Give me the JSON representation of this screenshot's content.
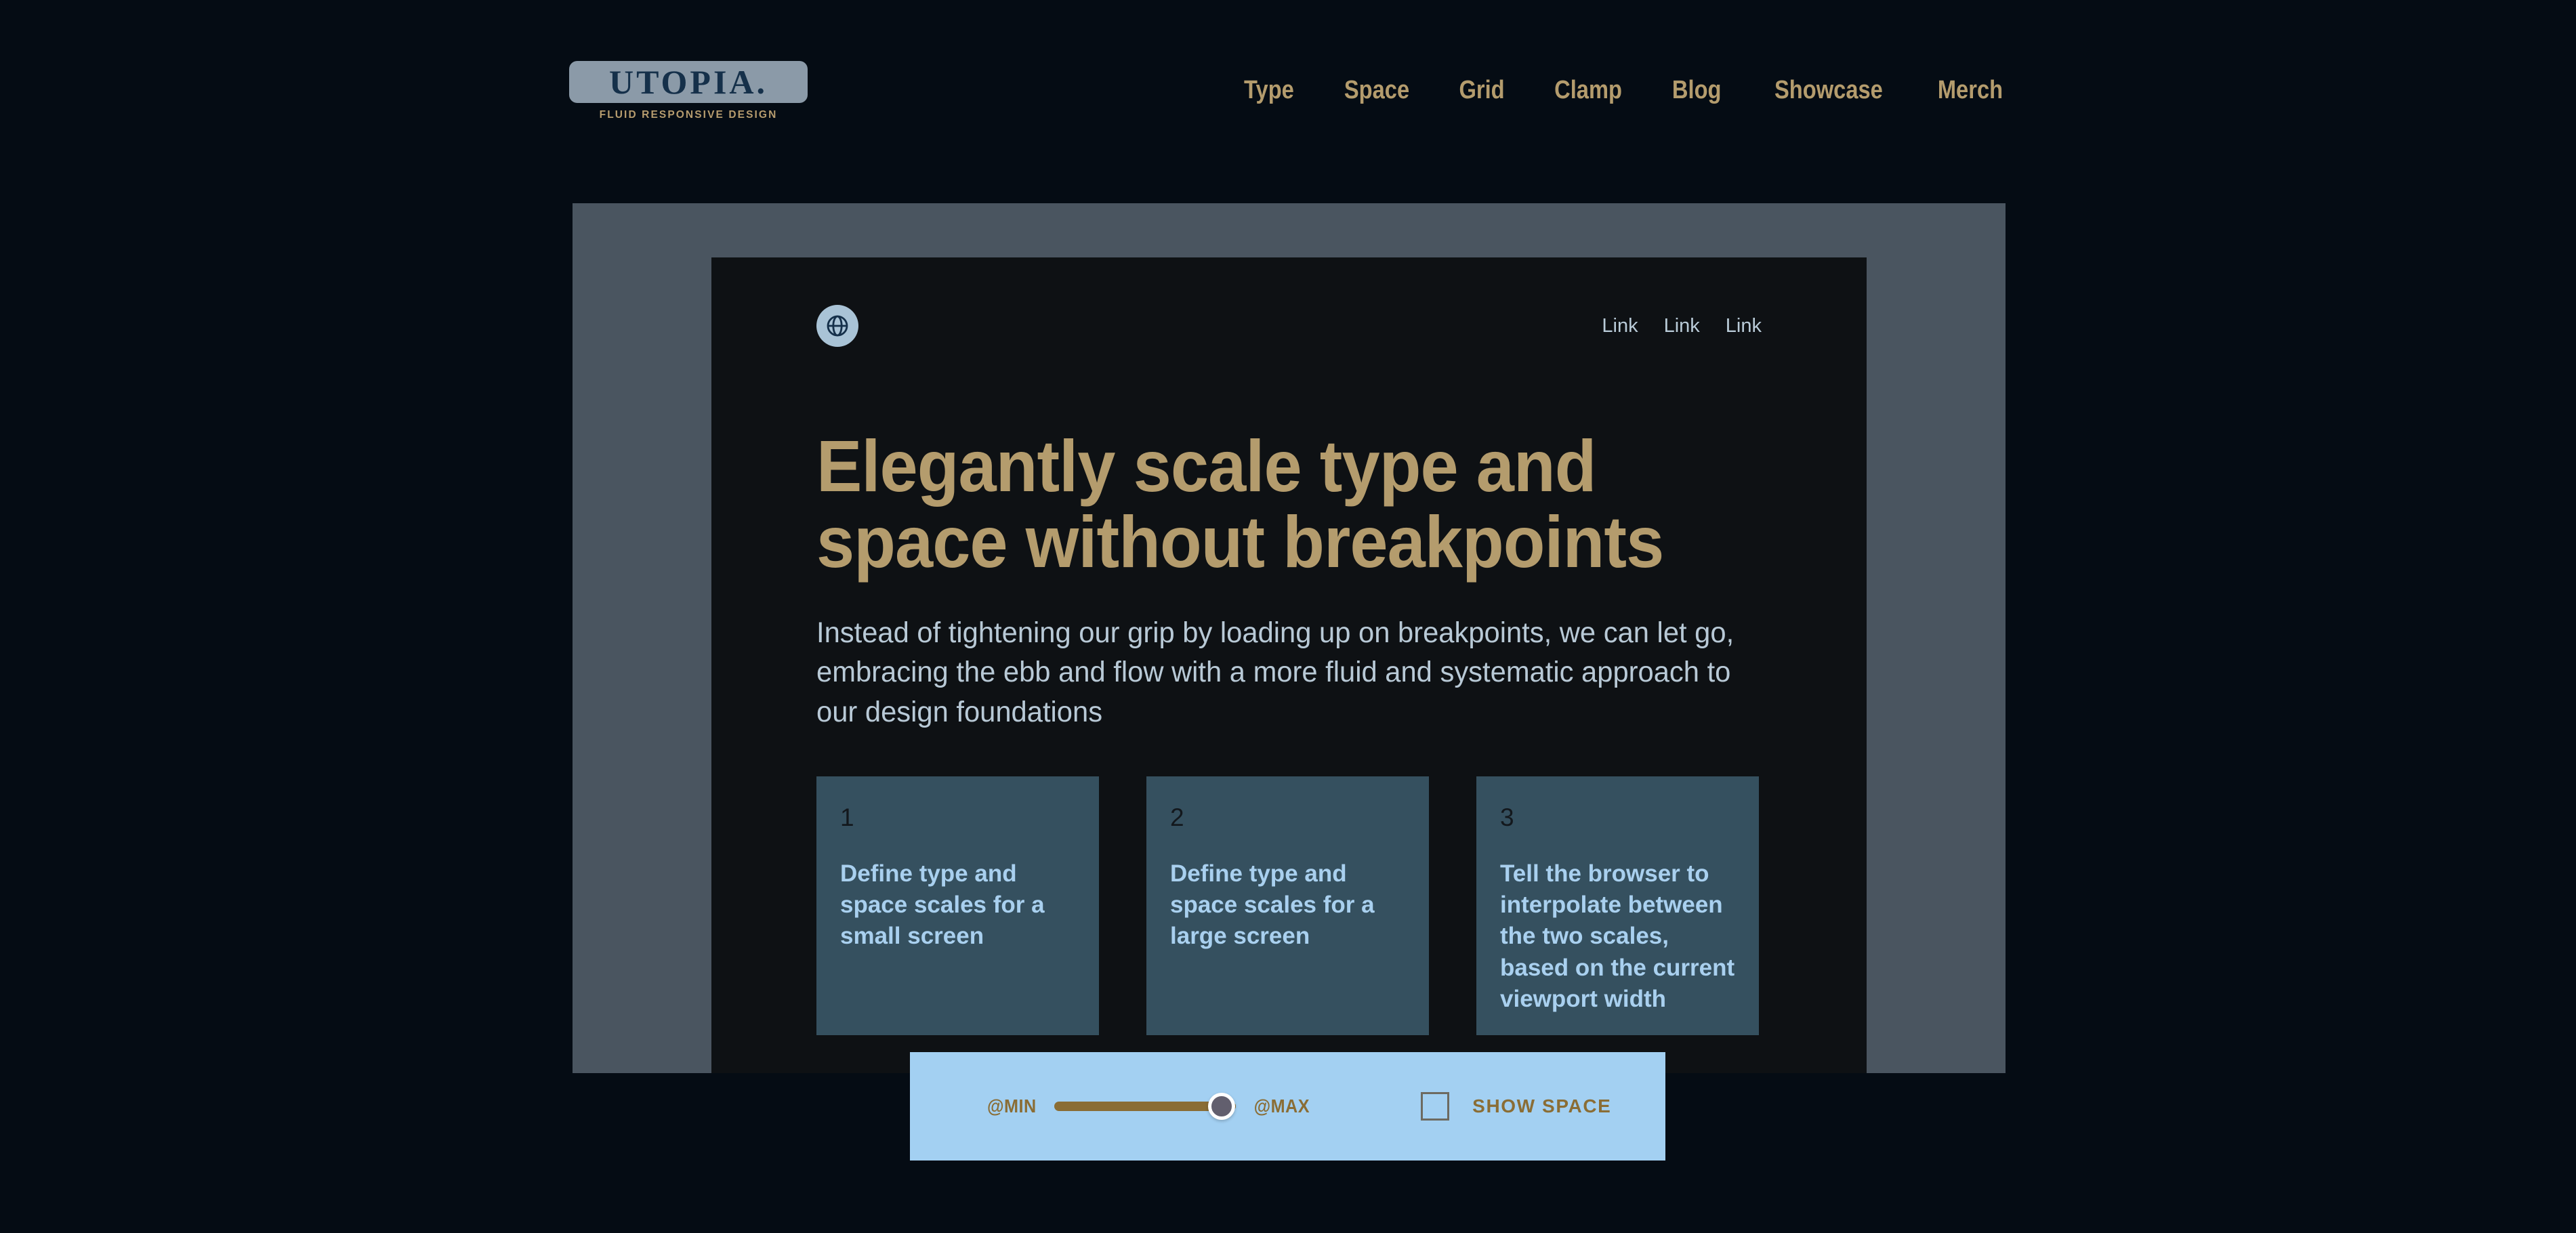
{
  "colors": {
    "page_background": "#050c14",
    "accent_tan": "#b49c6d",
    "frame_grey": "#4a5560",
    "preview_dark": "#0e1114",
    "card_blue": "#35505f",
    "card_text_blue": "#a9d0ef",
    "control_bar_blue": "#a3d0f2",
    "slider_brown": "#8a6d35",
    "slider_thumb": "#625f6e",
    "logo_badge": "#8b9aa8",
    "logo_word": "#15304a"
  },
  "header": {
    "brand": {
      "wordmark": "UTOPIA.",
      "tagline": "FLUID RESPONSIVE DESIGN"
    },
    "nav": [
      {
        "label": "Type"
      },
      {
        "label": "Space"
      },
      {
        "label": "Grid"
      },
      {
        "label": "Clamp"
      },
      {
        "label": "Blog"
      },
      {
        "label": "Showcase"
      },
      {
        "label": "Merch"
      }
    ]
  },
  "preview": {
    "logo_icon": "globe-icon",
    "links": [
      {
        "label": "Link"
      },
      {
        "label": "Link"
      },
      {
        "label": "Link"
      }
    ],
    "hero": {
      "title": "Elegantly scale type and space without breakpoints",
      "body": "Instead of tightening our grip by loading up on breakpoints, we can let go, embracing the ebb and flow with a more fluid and systematic approach to our design foundations"
    },
    "cards": [
      {
        "number": "1",
        "text": "Define type and space scales for a small screen"
      },
      {
        "number": "2",
        "text": "Define type and space scales for a large screen"
      },
      {
        "number": "3",
        "text": "Tell the browser to interpolate between the two scales, based on the current viewport width"
      }
    ]
  },
  "controls": {
    "slider": {
      "min_label": "@MIN",
      "max_label": "@MAX",
      "value_percent": 88
    },
    "show_space": {
      "label": "SHOW SPACE",
      "checked": false
    }
  }
}
